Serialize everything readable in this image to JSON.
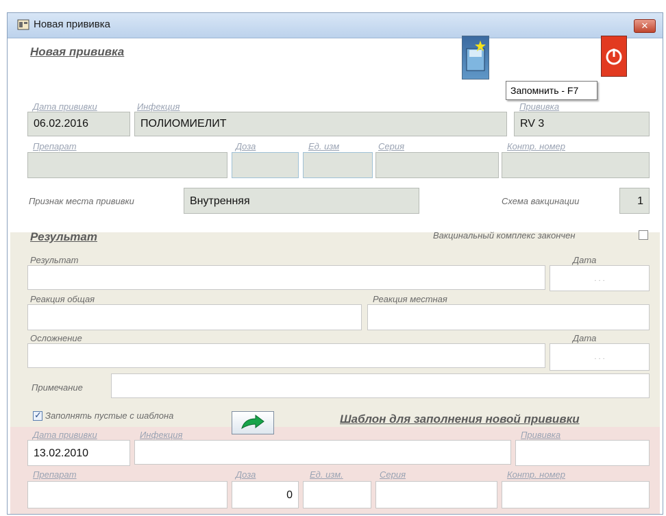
{
  "window": {
    "title": "Новая прививка",
    "close_label": "✕"
  },
  "header": {
    "title": "Новая прививка"
  },
  "toolbar": {
    "save_tooltip": "Запомнить - F7"
  },
  "vaccination": {
    "date_label": "Дата прививки",
    "date_value": "06.02.2016",
    "infection_label": "Инфекция",
    "infection_value": "ПОЛИОМИЕЛИТ",
    "vaccination_label": "Прививка",
    "vaccination_value": "RV 3",
    "drug_label": "Препарат",
    "drug_value": "",
    "dose_label": "Доза",
    "dose_value": "",
    "unit_label": "Ед. изм",
    "unit_value": "",
    "series_label": "Серия",
    "series_value": "",
    "control_label": "Контр. номер",
    "control_value": "",
    "site_label": "Признак места прививки",
    "site_value": "Внутренняя",
    "scheme_label": "Схема вакцинации",
    "scheme_value": "1"
  },
  "result": {
    "title": "Результат",
    "complex_done_label": "Вакцинальный комплекс закончен",
    "complex_done": false,
    "result_label": "Результат",
    "result_value": "",
    "result_date_label": "Дата",
    "result_date_value": ". . .",
    "general_label": "Реакция общая",
    "general_value": "",
    "local_label": "Реакция местная",
    "local_value": "",
    "complication_label": "Осложнение",
    "complication_value": "",
    "complication_date_label": "Дата",
    "complication_date_value": ". . .",
    "note_label": "Примечание",
    "note_value": ""
  },
  "template": {
    "fill_label": "Заполнять пустые с шаблона",
    "fill_checked": true,
    "title": "Шаблон для заполнения новой прививки",
    "date_label": "Дата прививки",
    "date_value": "13.02.2010",
    "infection_label": "Инфекция",
    "infection_value": "",
    "vaccination_label": "Прививка",
    "vaccination_value": "",
    "drug_label": "Препарат",
    "drug_value": "",
    "dose_label": "Доза",
    "dose_value": "0",
    "unit_label": "Ед. изм.",
    "unit_value": "",
    "series_label": "Серия",
    "series_value": "",
    "control_label": "Контр. номер",
    "control_value": ""
  },
  "icons": {
    "window": "form-icon",
    "save": "save-icon",
    "power": "power-icon",
    "apply": "green-arrow-icon"
  },
  "colors": {
    "save_button": "#4f86c0",
    "power_button": "#e23a20",
    "result_panel": "#efede2",
    "template_panel": "#f3e0dd"
  }
}
